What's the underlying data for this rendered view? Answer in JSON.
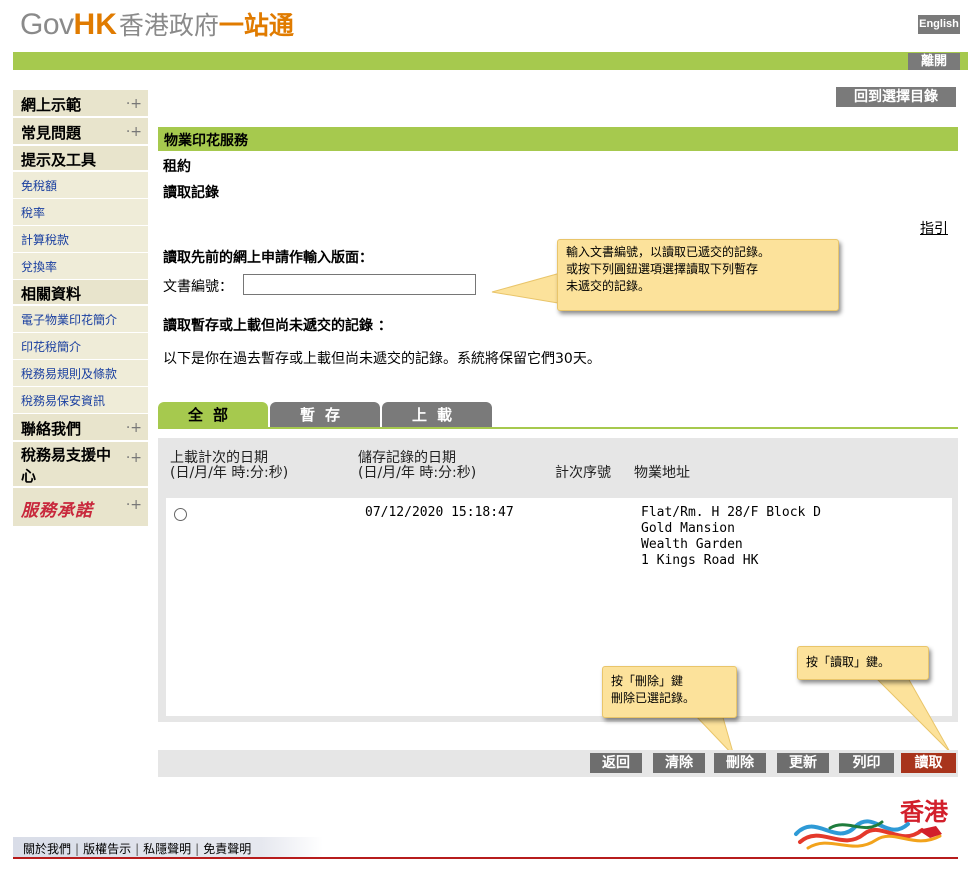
{
  "header": {
    "logo_gov": "Gov",
    "logo_hk": "HK",
    "logo_zh": "香港政府",
    "logo_zh2": "一站通",
    "lang_button": "English",
    "leave_button": "離開"
  },
  "sidebar": {
    "items": [
      {
        "label": "網上示範"
      },
      {
        "label": "常見問題"
      }
    ],
    "tools_heading": "提示及工具",
    "tools": [
      "免稅額",
      "稅率",
      "計算稅款",
      "兌換率"
    ],
    "related_heading": "相關資料",
    "related": [
      "電子物業印花簡介",
      "印花稅簡介",
      "稅務易規則及條款",
      "稅務易保安資訊"
    ],
    "contact": "聯絡我們",
    "support": "稅務易支援中心",
    "serve_logo": "服務承諾",
    "plus_icon": "expand-plus-icon"
  },
  "main": {
    "back_to_menu": "回到選擇目錄",
    "section_title": "物業印花服務",
    "subtitle1": "租約",
    "subtitle2": "讀取記錄",
    "guide_link": "指引",
    "retrieve_heading": "讀取先前的網上申請作輸入版面：",
    "doc_no_label": "文書編號：",
    "doc_no_value": "",
    "pending_heading": "讀取暫存或上載但尚未遞交的記錄 ：",
    "info_text": "以下是你在過去暫存或上載但尚未遞交的記錄。系統將保留它們30天。",
    "tooltip_input": [
      "輸入文書編號，以讀取已遞交的記錄。",
      "或按下列圓鈕選項選擇讀取下列暫存",
      "未遞交的記錄。"
    ],
    "tabs": [
      {
        "label": "全部",
        "active": true
      },
      {
        "label": "暫存",
        "active": false
      },
      {
        "label": "上載",
        "active": false
      }
    ],
    "table": {
      "headers": {
        "upload_date": [
          "上載計次的日期",
          "(日/月/年 時:分:秒)"
        ],
        "save_date": [
          "儲存記錄的日期",
          "(日/月/年 時:分:秒)"
        ],
        "seq": "計次序號",
        "address": "物業地址"
      },
      "rows": [
        {
          "selected": false,
          "upload_date": "",
          "save_date": "07/12/2020 15:18:47",
          "seq": "",
          "address": [
            "Flat/Rm. H 28/F Block D",
            "Gold Mansion",
            "Wealth Garden",
            "1 Kings Road HK"
          ]
        }
      ]
    },
    "tooltip_delete": [
      "按「刪除」鍵",
      "刪除已選記錄。"
    ],
    "tooltip_read": "按「讀取」鍵。",
    "buttons": {
      "back": "返回",
      "clear": "清除",
      "delete": "刪除",
      "refresh": "更新",
      "print": "列印",
      "read": "讀取"
    }
  },
  "footer": {
    "links": [
      "關於我們",
      "版權告示",
      "私隱聲明",
      "免責聲明"
    ],
    "brand_logo": "香港",
    "brand_icon": "hong-kong-dragon-logo-icon"
  },
  "colors": {
    "accent_green": "#a6c94e",
    "button_grey": "#7a7a7a",
    "read_button_red": "#a8341c",
    "sidebar_beige": "#e8e4cc",
    "tooltip_yellow": "#fce29b"
  }
}
